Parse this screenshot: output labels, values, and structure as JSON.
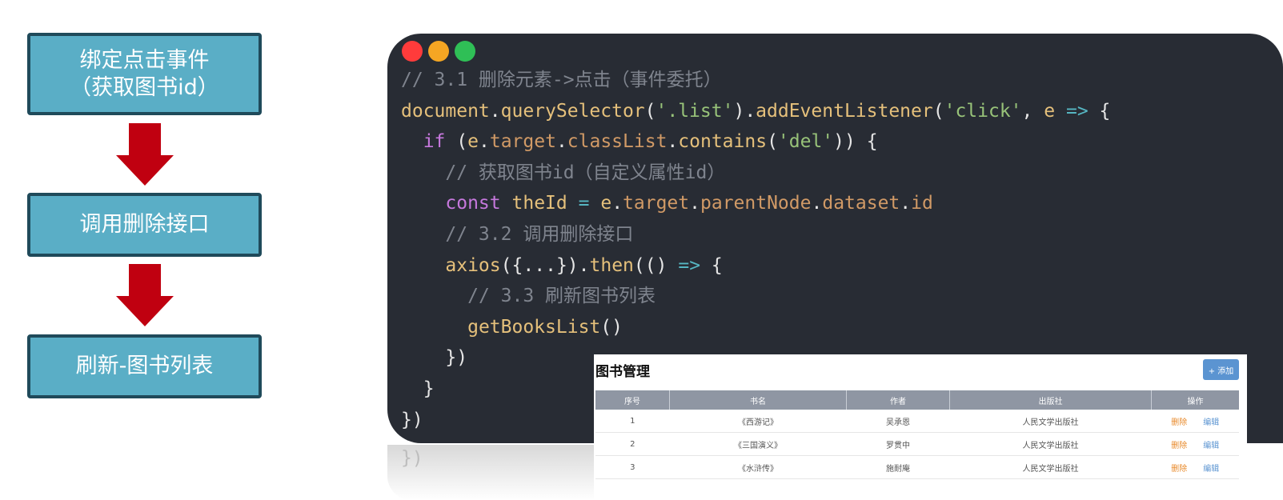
{
  "flow": {
    "step1_line1": "绑定点击事件",
    "step1_line2": "（获取图书id）",
    "step2": "调用删除接口",
    "step3": "刷新-图书列表"
  },
  "code_lines": [
    "// 3.1 删除元素->点击（事件委托）",
    "document.querySelector('.list').addEventListener('click', e => {",
    "  if (e.target.classList.contains('del')) {",
    "    // 获取图书id（自定义属性id）",
    "    const theId = e.target.parentNode.dataset.id",
    "    // 3.2 调用删除接口",
    "    axios({...}).then(() => {",
    "      // 3.3 刷新图书列表",
    "      getBooksList()",
    "    })",
    "  }",
    "})"
  ],
  "reflection_text": "})",
  "book_table": {
    "title": "图书管理",
    "add_button": "+ 添加",
    "headers": [
      "序号",
      "书名",
      "作者",
      "出版社",
      "操作"
    ],
    "rows": [
      {
        "index": "1",
        "name": "《西游记》",
        "author": "吴承恩",
        "publisher": "人民文学出版社"
      },
      {
        "index": "2",
        "name": "《三国演义》",
        "author": "罗贯中",
        "publisher": "人民文学出版社"
      },
      {
        "index": "3",
        "name": "《水浒传》",
        "author": "施耐庵",
        "publisher": "人民文学出版社"
      }
    ],
    "delete_label": "删除",
    "edit_label": "编辑"
  },
  "colors": {
    "flow_box": "#5aaec6",
    "arrow": "#c00010",
    "code_bg": "#282c34",
    "traffic_red": "#ff3b3b",
    "traffic_yellow": "#f5a623",
    "traffic_green": "#2fbf56"
  }
}
